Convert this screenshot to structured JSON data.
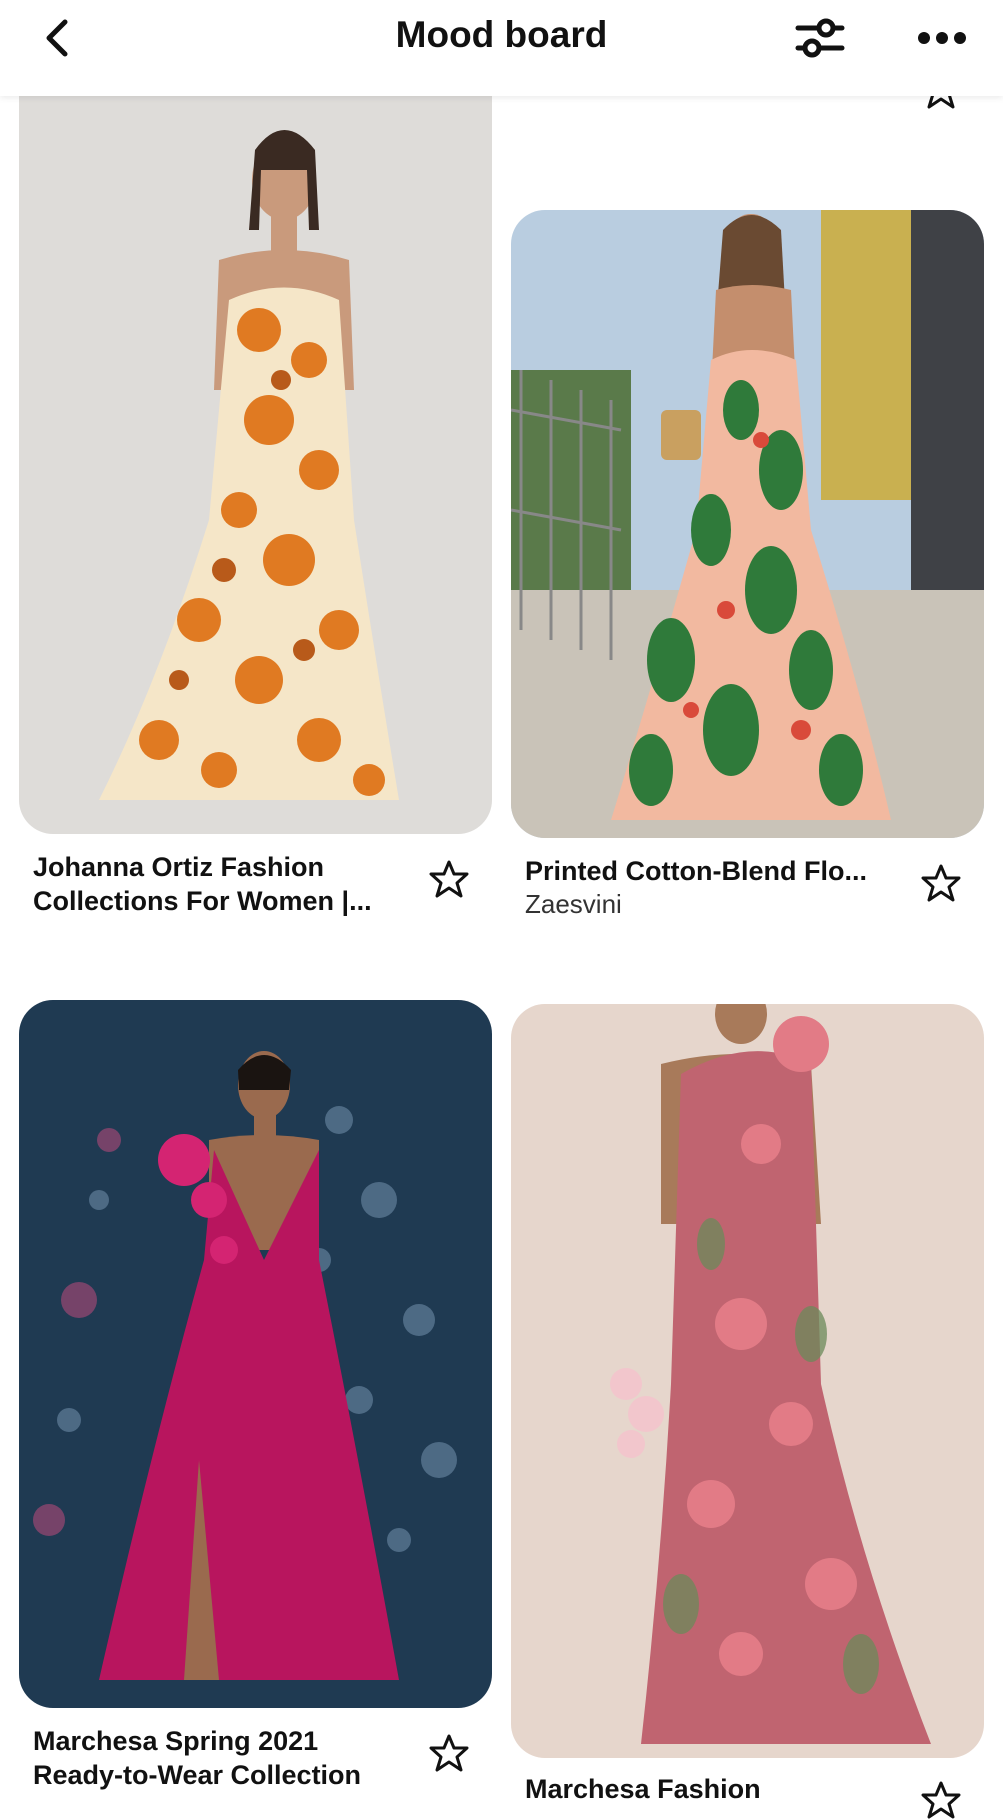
{
  "header": {
    "title": "Mood board",
    "back_icon": "chevron-left-icon",
    "filter_icon": "sliders-icon",
    "more_icon": "ellipsis-icon"
  },
  "pins": [
    {
      "title_line1": "Johanna Ortiz Fashion",
      "title_line2": "Collections For Women |...",
      "source": "",
      "image": "orange floral print maxi gown"
    },
    {
      "title_line1": "Printed Cotton-Blend Flo...",
      "title_line2": "",
      "source": "Zaesvini",
      "image": "tropical print maxi dress street style"
    },
    {
      "title_line1": "Marchesa Spring 2021",
      "title_line2": "Ready-to-Wear Collection",
      "source": "",
      "image": "magenta ruffled gown"
    },
    {
      "title_line1": "Marchesa Fashion",
      "title_line2": "",
      "source": "",
      "image": "floral one-shoulder gown"
    }
  ],
  "colors": {
    "accent_text": "#111111",
    "background": "#ffffff"
  }
}
